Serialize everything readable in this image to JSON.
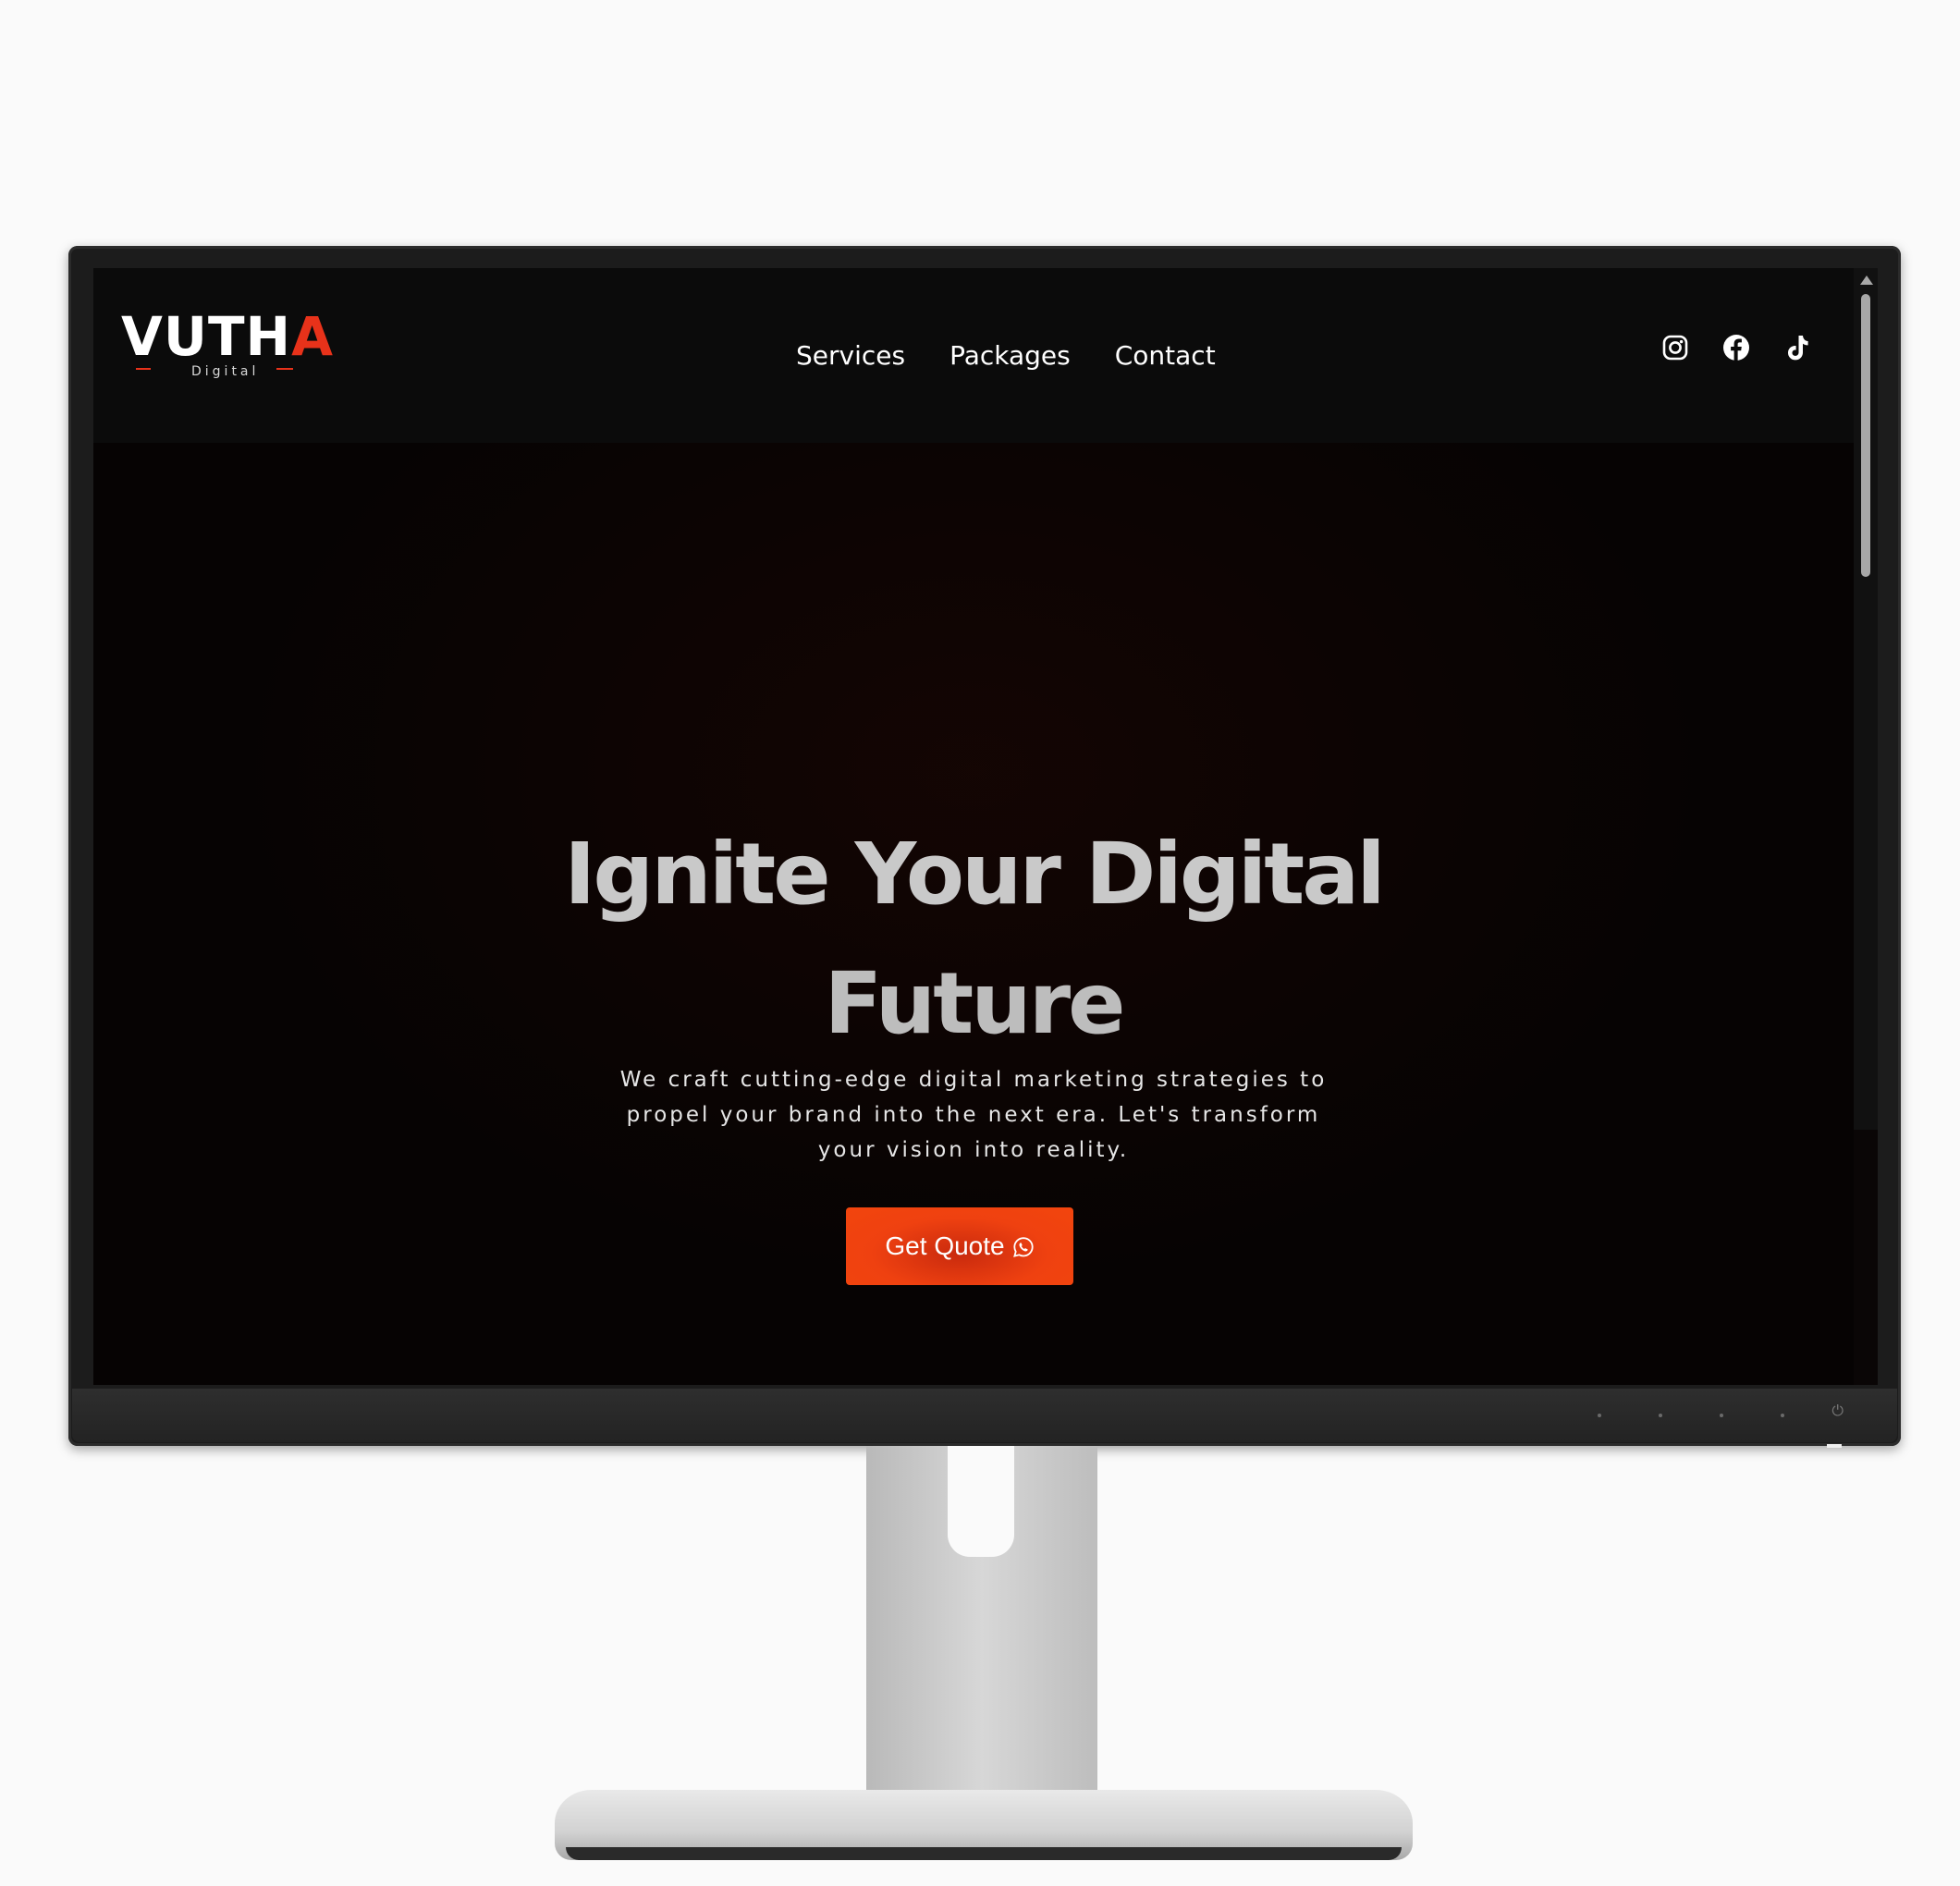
{
  "brand": {
    "logo_word": "VUTH",
    "logo_accent": "A",
    "logo_sub": "Digital",
    "accent_color": "#e8321a"
  },
  "nav": {
    "items": [
      {
        "label": "Services"
      },
      {
        "label": "Packages"
      },
      {
        "label": "Contact"
      }
    ]
  },
  "social": {
    "icons": [
      "instagram-icon",
      "facebook-icon",
      "tiktok-icon"
    ]
  },
  "hero": {
    "title_line1": "Ignite Your Digital",
    "title_line2": "Future",
    "subtitle": "We craft cutting-edge digital marketing strategies to propel your brand into the next era. Let's transform your vision into reality.",
    "cta_label": "Get Quote",
    "cta_icon": "whatsapp-icon",
    "cta_color": "#f2450d"
  },
  "monitor": {
    "power_symbol": "⏻"
  }
}
